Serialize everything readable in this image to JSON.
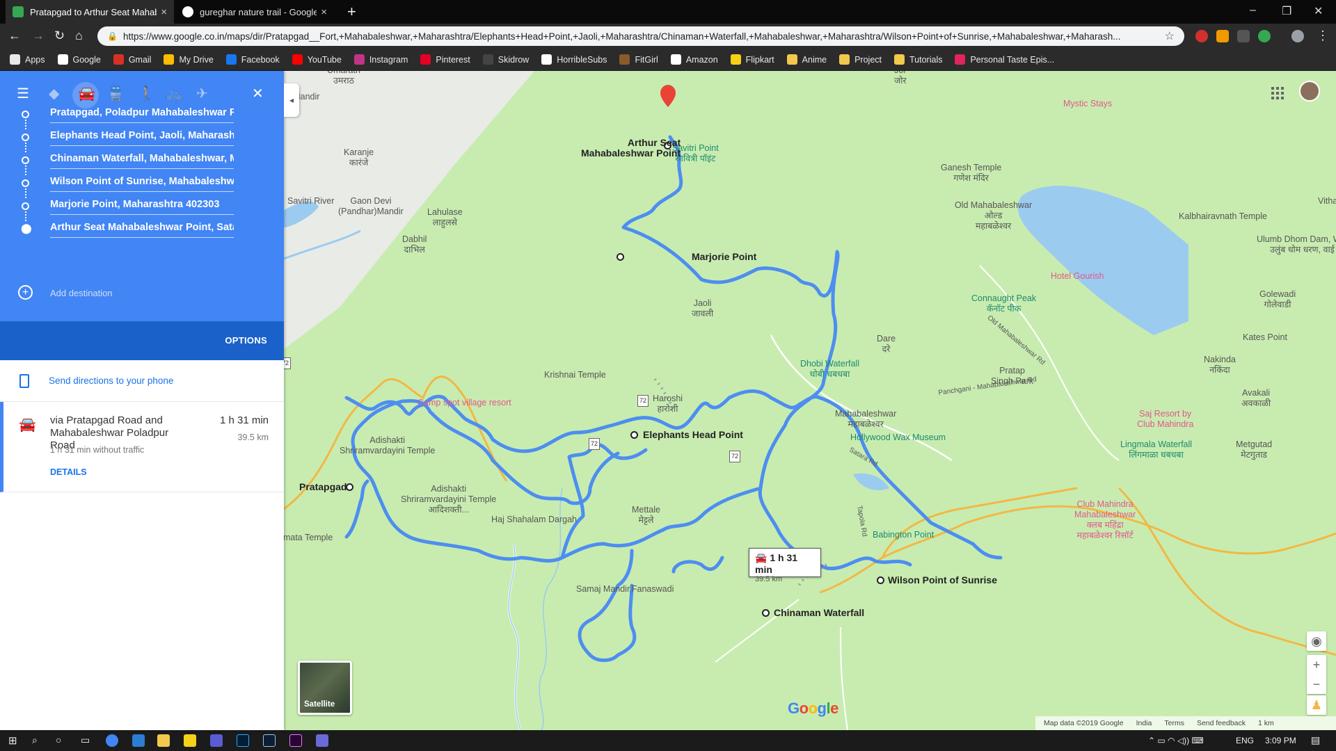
{
  "browser": {
    "tabs": [
      {
        "title": "Pratapgad to Arthur Seat Mahab",
        "active": true,
        "close": "×",
        "favicon_color": "#34a853"
      },
      {
        "title": "gureghar nature trail - Google Se",
        "active": false,
        "close": "×",
        "favicon_color": "#ffffff"
      }
    ],
    "new_tab": "+",
    "window_controls": {
      "minimize": "–",
      "maximize": "❐",
      "close": "✕"
    },
    "nav": {
      "back": "←",
      "forward": "→",
      "reload": "↻",
      "home": "⌂"
    },
    "url": "https://www.google.co.in/maps/dir/Pratapgad__Fort,+Mahabaleshwar,+Maharashtra/Elephants+Head+Point,+Jaoli,+Maharashtra/Chinaman+Waterfall,+Mahabaleshwar,+Maharashtra/Wilson+Point+of+Sunrise,+Mahabaleshwar,+Maharash...",
    "bookmarks": [
      {
        "label": "Apps",
        "color": "#e8e8e8"
      },
      {
        "label": "Google",
        "color": "#ffffff"
      },
      {
        "label": "Gmail",
        "color": "#d93025"
      },
      {
        "label": "My Drive",
        "color": "#fbbc04"
      },
      {
        "label": "Facebook",
        "color": "#1877f2"
      },
      {
        "label": "YouTube",
        "color": "#ff0000"
      },
      {
        "label": "Instagram",
        "color": "#c13584"
      },
      {
        "label": "Pinterest",
        "color": "#e60023"
      },
      {
        "label": "Skidrow",
        "color": "#444444"
      },
      {
        "label": "HorribleSubs",
        "color": "#ffffff"
      },
      {
        "label": "FitGirl",
        "color": "#8b5a2b"
      },
      {
        "label": "Amazon",
        "color": "#ffffff"
      },
      {
        "label": "Flipkart",
        "color": "#f7d117"
      },
      {
        "label": "Anime",
        "color": "#f2c94c"
      },
      {
        "label": "Project",
        "color": "#f2c94c"
      },
      {
        "label": "Tutorials",
        "color": "#f2c94c"
      },
      {
        "label": "Personal Taste Epis...",
        "color": "#e0245e"
      }
    ]
  },
  "directions": {
    "menu_icon": "hamburger-menu-icon",
    "close": "✕",
    "waypoints": [
      "Pratapgad, Poladpur Mahabaleshwar R",
      "Elephants Head Point, Jaoli, Maharasht",
      "Chinaman Waterfall, Mahabaleshwar, M",
      "Wilson Point of Sunrise, Mahabaleshwa",
      "Marjorie Point, Maharashtra 402303",
      "Arthur Seat Mahabaleshwar Point, Sata"
    ],
    "add_destination": "Add destination",
    "options": "OPTIONS",
    "send_to_phone": "Send directions to your phone",
    "route": {
      "via": "via Pratapgad Road and Mahabaleshwar Poladpur Road",
      "time": "1 h 31 min",
      "distance": "39.5 km",
      "traffic": "1 h 31 min without traffic",
      "details": "DETAILS"
    },
    "collapse": "◂"
  },
  "map": {
    "tooltip": {
      "time": "1 h 31 min",
      "distance": "39.5 km"
    },
    "waypoint_labels": {
      "arthur": "Arthur Seat\nMahabaleshwar Point",
      "marjorie": "Marjorie Point",
      "elephants": "Elephants Head Point",
      "pratapgad": "Pratapgad",
      "wilson": "Wilson Point of Sunrise",
      "chinaman": "Chinaman Waterfall"
    },
    "places": {
      "umarath": "Umarath\nउमराठ",
      "jor": "Jor\nजोर",
      "mandir": "ai Mandir",
      "karanje": "Karanje\nकारंजे",
      "savitri_river": "Savitri River",
      "gaon_devi": "Gaon Devi\n(Pandhar)Mandir",
      "lahulase": "Lahulase\nलाहुलसे",
      "dabhil": "Dabhil\nदाभिल",
      "savitri_point": "Savitri Point\nसावित्री पॉइंट",
      "mystic": "Mystic Stays",
      "ganesh": "Ganesh Temple\nगणेश मंदिर",
      "old_mbw": "Old Mahabaleshwar\nओल्ड\nमहाबळेश्वर",
      "kalbhairav": "Kalbhairavnath Temple",
      "vitha": "Vitha",
      "ulumb": "Ulumb Dhom Dam, Wai\nउलुंब धोम धरण, वाई",
      "hotel_gourish": "Hotel Gourish",
      "golewadi": "Golewadi\nगोलेवाडी",
      "connaught": "Connaught Peak\nकॅनॉट पीक",
      "jaoli": "Jaoli\nजावली",
      "dare": "Dare\nदरे",
      "kates": "Kates Point",
      "nakinda": "Nakinda\nनकिंदा",
      "dhobi": "Dhobi Waterfall\nधोबी धबधबा",
      "krishnai": "Krishnai Temple",
      "pratap_park": "Pratap\nSingh Park",
      "panchgani_rd": "Panchgani - Mahabaleshwar Rd",
      "avakali": "Avakali\nअवकाळी",
      "harosh": "Haroshi\nहारोशी",
      "mbw": "Mahabaleshwar\nमहाबळेश्वर",
      "saj": "Saj Resort by\nClub Mahindra",
      "village_resort": "Camp spot village resort",
      "adishakti1": "Adishakti\nShriramvardayini Temple",
      "hollywood": "Hollywood Wax Museum",
      "lingmala": "Lingmala Waterfall\nलिंगमाळा धबधबा",
      "metgutad": "Metgutad\nमेटगुताड",
      "adishakti2": "Adishakti\nShriramvardayini Temple\nआदिशक्ती...",
      "mettale": "Mettale\nमेट्टले",
      "club_mahindra": "Club Mahindra\nMahabaleshwar\nक्लब महिंद्रा\nमहाबळेश्वर रिसॉर्ट",
      "haj": "Haj Shahalam Dargah",
      "babington": "Babington Point",
      "amata": "amata Temple",
      "samaj": "Samaj Mandir,Fanaswadi",
      "wai_rd": "Old Mahabaleshwar Rd",
      "tapola_rd": "Tapola Rd",
      "hatara_rd": "Satara Rd"
    },
    "shields": [
      "72",
      "72",
      "72",
      "72"
    ],
    "satellite": "Satellite",
    "google": "Google",
    "footer": {
      "data": "Map data ©2019 Google",
      "country": "India",
      "terms": "Terms",
      "feedback": "Send feedback",
      "scale": "1 km"
    },
    "colors": {
      "land": "#c8ecb0",
      "route": "#4d8ef0",
      "road_orange": "#f2b844",
      "water": "#9ccbf0"
    }
  },
  "taskbar": {
    "lang": "ENG",
    "time": "3:09 PM"
  }
}
